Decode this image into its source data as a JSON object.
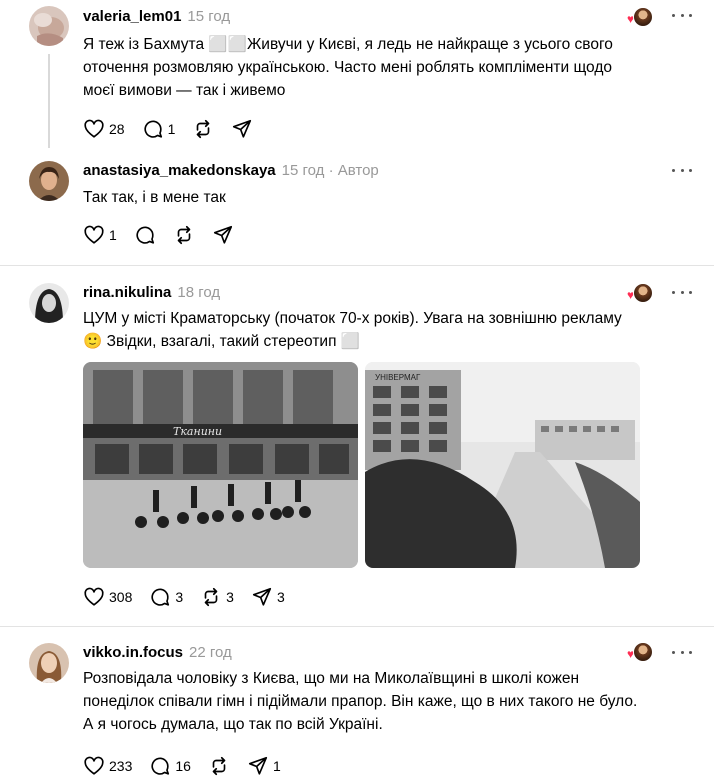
{
  "posts": [
    {
      "username": "valeria_lem01",
      "time": "15 год",
      "text_lines": [
        "Я теж із Бахмута ⬜⬜Живучи у Києві, я ледь не найкраще з усього свого",
        "оточення розмовляю українською. Часто мені роблять компліменти щодо",
        "моєї вимови — так і живемо"
      ],
      "likes": "28",
      "replies": "1",
      "reposts": "",
      "shares": ""
    },
    {
      "username": "anastasiya_makedonskaya",
      "time": "15 год",
      "author_label": "· Автор",
      "text_lines": [
        "Так так, і в мене так"
      ],
      "likes": "1",
      "replies": "",
      "reposts": "",
      "shares": ""
    },
    {
      "username": "rina.nikulina",
      "time": "18 год",
      "text_lines": [
        "ЦУМ у місті Краматорську (початок 70-х років). Увага на зовнішню рекламу",
        "🙂 Звідки, взагалі, такий стереотип ⬜"
      ],
      "image_captions": [
        "Тканини",
        "УНІВЕРМАГ"
      ],
      "likes": "308",
      "replies": "3",
      "reposts": "3",
      "shares": "3"
    },
    {
      "username": "vikko.in.focus",
      "time": "22 год",
      "text_lines": [
        "Розповідала чоловіку з Києва, що ми на Миколаївщині в школі кожен",
        "понеділок співали гімн і підіймали прапор. Він каже, що в них такого не було.",
        "А я чогось думала, що так по всій Україні."
      ],
      "likes": "233",
      "replies": "16",
      "reposts": "",
      "shares": "1"
    }
  ],
  "icons": {
    "like": "heart-icon",
    "reply": "comment-icon",
    "repost": "repost-icon",
    "share": "send-icon",
    "more": "more-icon"
  },
  "colors": {
    "muted": "#999999",
    "liked_heart": "#ff2e54",
    "divider": "#e3e3e3"
  }
}
